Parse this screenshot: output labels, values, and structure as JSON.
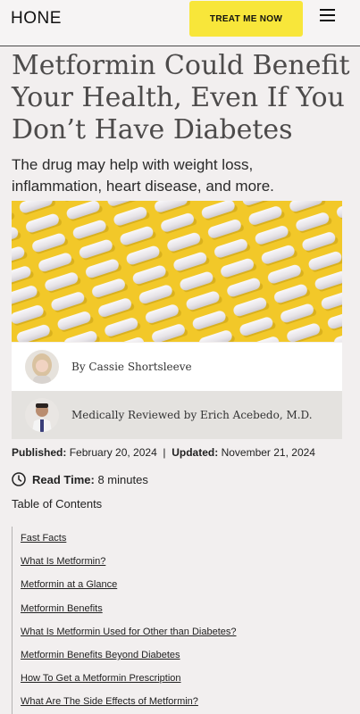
{
  "header": {
    "logo": "HONE",
    "cta_label": "TREAT ME NOW",
    "menu_icon": "hamburger-menu-icon"
  },
  "article": {
    "title": "Metformin Could Benefit Your Health, Even If You Don’t Have Diabetes",
    "subtitle": "The drug may help with weight loss, inflammation, heart disease, and more.",
    "author_line": "By Cassie Shortsleeve",
    "reviewer_line": "Medically Reviewed by Erich Acebedo, M.D.",
    "published_label": "Published:",
    "published_date": "February 20, 2024",
    "separator": "|",
    "updated_label": "Updated:",
    "updated_date": "November 21, 2024",
    "read_time_label": "Read Time:",
    "read_time_value": "8 minutes"
  },
  "toc": {
    "title": "Table of Contents",
    "items": [
      "Fast Facts",
      "What Is Metformin?",
      "Metformin at a Glance",
      "Metformin Benefits",
      "What Is Metformin Used for Other than Diabetes?",
      "Metformin Benefits Beyond Diabetes",
      "How To Get a Metformin Prescription",
      "What Are The Side Effects of Metformin?"
    ]
  },
  "colors": {
    "background": "#f2efef",
    "cta": "#f8e63a",
    "hero_background": "#f2c829",
    "pill": "#ece9ec"
  }
}
